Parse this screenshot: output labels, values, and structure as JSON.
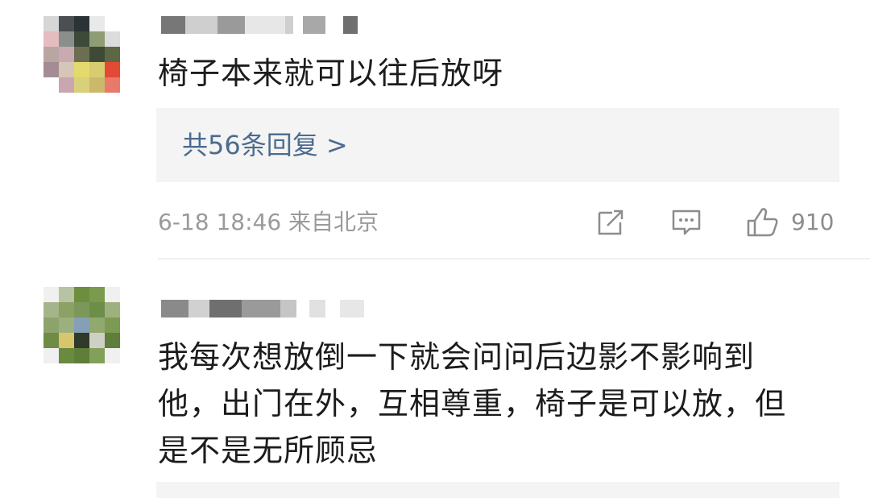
{
  "comments": [
    {
      "text": "椅子本来就可以往后放呀",
      "reply_label": "共56条回复 >",
      "meta": "6-18 18:46 来自北京",
      "likes": "910",
      "icons": [
        "share-icon",
        "comment-icon",
        "like-icon"
      ]
    },
    {
      "text_lines": [
        "我每次想放倒一下就会问问后边影不影响到",
        "他，出门在外，互相尊重，椅子是可以放，但",
        "是不是无所顾忌"
      ]
    }
  ],
  "colors": {
    "reply_link": "#4b6b8f",
    "meta_text": "#9a9a9a",
    "body_text": "#1c1c1c",
    "reply_box_bg": "#f4f4f4"
  }
}
